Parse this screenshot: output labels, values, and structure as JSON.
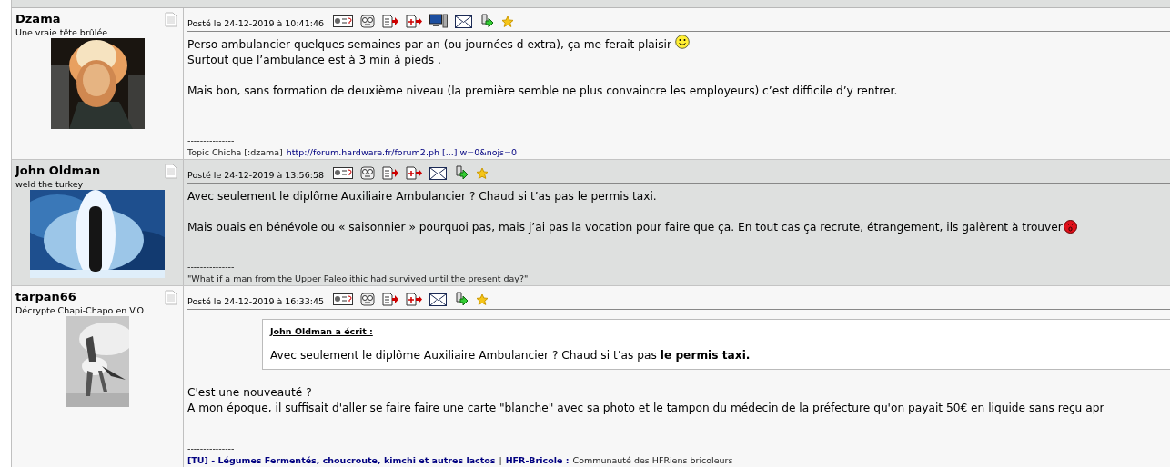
{
  "posts": [
    {
      "author": "Dzama",
      "tagline": "Une vraie tête brûlée",
      "avatar": {
        "kind": "picture"
      },
      "date": "Posté le 24-12-2019 à 10:41:46",
      "tools": [
        {
          "kind": "profile"
        },
        {
          "kind": "face"
        },
        {
          "kind": "edit"
        },
        {
          "kind": "add"
        },
        {
          "kind": "computer"
        },
        {
          "kind": "mail"
        },
        {
          "kind": "alert"
        },
        {
          "kind": "star"
        }
      ],
      "body": [
        {
          "kind": "line",
          "text": "Perso ambulancier quelques semaines par an (ou journées d extra), ça me ferait plaisir",
          "emoticon": {
            "kind": "smile"
          }
        },
        {
          "kind": "line",
          "text": "Surtout que l’ambulance est à 3 min à pieds ."
        },
        {
          "kind": "gap"
        },
        {
          "kind": "line",
          "text": "Mais bon, sans formation de deuxième niveau (la première semble ne plus convaincre les employeurs) c’est difficile d’y rentrer."
        }
      ],
      "separator": "---------------",
      "signature": [
        {
          "kind": "text",
          "text": "Topic Chicha [:dzama]"
        },
        {
          "kind": "link",
          "text": "http://forum.hardware.fr/forum2.ph [...] w=0&nojs=0"
        }
      ]
    },
    {
      "author": "John Oldman",
      "tagline": "weld the turkey",
      "avatar": {
        "kind": "picture"
      },
      "date": "Posté le 24-12-2019 à 13:56:58",
      "tools": [
        {
          "kind": "profile"
        },
        {
          "kind": "face"
        },
        {
          "kind": "edit"
        },
        {
          "kind": "add"
        },
        {
          "kind": "mail"
        },
        {
          "kind": "alert"
        },
        {
          "kind": "star"
        }
      ],
      "body": [
        {
          "kind": "line",
          "text": "Avec seulement le diplôme Auxiliaire Ambulancier ? Chaud si t’as pas le permis taxi."
        },
        {
          "kind": "gap"
        },
        {
          "kind": "line",
          "text": "Mais ouais en bénévole ou « saisonnier » pourquoi pas, mais j’ai pas la vocation pour faire que ça. En tout cas ça recrute, étrangement, ils  galèrent à trouver",
          "emoticon": {
            "kind": "angry"
          }
        }
      ],
      "separator": "---------------",
      "signature": [
        {
          "kind": "text",
          "text": "\"What if a man from the Upper Paleolithic had survived until the present day?\""
        }
      ]
    },
    {
      "author": "tarpan66",
      "tagline": "Décrypte Chapi-Chapo en V.O.",
      "avatar": {
        "kind": "picture"
      },
      "date": "Posté le 24-12-2019 à 16:33:45",
      "tools": [
        {
          "kind": "profile"
        },
        {
          "kind": "face"
        },
        {
          "kind": "edit"
        },
        {
          "kind": "add"
        },
        {
          "kind": "mail"
        },
        {
          "kind": "alert"
        },
        {
          "kind": "star"
        }
      ],
      "body": [
        {
          "kind": "quote",
          "author": "John Oldman a écrit :",
          "text": "Avec seulement le diplôme Auxiliaire Ambulancier ? Chaud si t’as pas **le permis taxi.**"
        },
        {
          "kind": "gap"
        },
        {
          "kind": "line",
          "text": "C'est une nouveauté ?"
        },
        {
          "kind": "line",
          "text": "A mon époque, il suffisait d'aller se faire faire une carte \"blanche\" avec sa photo et le tampon du médecin de la préfecture qu'on payait 50€ en liquide sans reçu apr"
        }
      ],
      "separator": "---------------",
      "signature": [
        {
          "kind": "bold-link",
          "text": "[TU] - Légumes Fermentés, choucroute, kimchi et autres lactos"
        },
        {
          "kind": "text",
          "text": "|"
        },
        {
          "kind": "bold-link",
          "text": "HFR-Bricole :"
        },
        {
          "kind": "text",
          "text": "Communauté des HFRiens bricoleurs"
        }
      ]
    }
  ]
}
